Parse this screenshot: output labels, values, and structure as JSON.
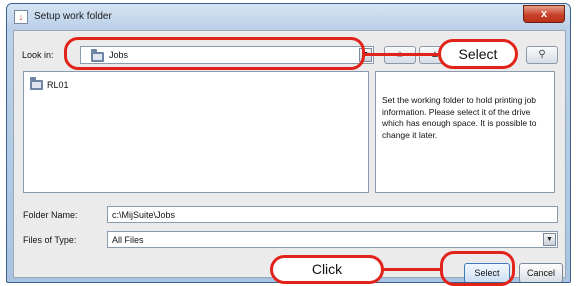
{
  "window": {
    "title": "Setup work folder",
    "app_icon_glyph": "↓",
    "close_glyph": "x"
  },
  "lookin": {
    "label": "Look in:",
    "value": "Jobs",
    "arrow_glyph": "▼"
  },
  "toolbar": {
    "up_glyph": "⌂",
    "home_glyph": "▲",
    "search_glyph": "⚲"
  },
  "file_list": {
    "items": [
      {
        "name": "RL01",
        "icon": "folder-icon"
      }
    ]
  },
  "description": "Set the working folder to hold printing job information. Please select it of the drive which has enough space. It is possible to change it later.",
  "folder_name": {
    "label": "Folder Name:",
    "value": "c:\\MijSuite\\Jobs"
  },
  "files_of_type": {
    "label": "Files of Type:",
    "value": "All Files",
    "arrow_glyph": "▼"
  },
  "buttons": {
    "select": "Select",
    "cancel": "Cancel"
  },
  "annotations": {
    "select_callout": "Select",
    "click_callout": "Click",
    "color": "#e2231a"
  }
}
